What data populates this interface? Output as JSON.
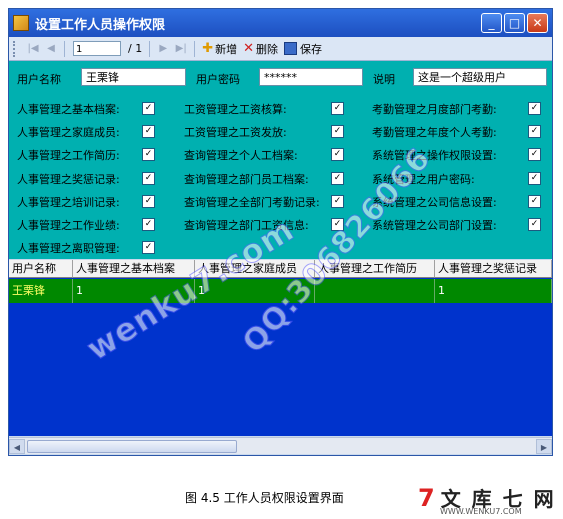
{
  "window": {
    "title": "设置工作人员操作权限",
    "btn_min": "_",
    "btn_max": "□",
    "btn_close": "✕"
  },
  "toolbar": {
    "nav_first": "|◀",
    "nav_prev": "◀",
    "position": "1",
    "total": "/ 1",
    "nav_next": "▶",
    "nav_last": "▶|",
    "add_label": "新增",
    "delete_label": "删除",
    "save_label": "保存"
  },
  "form": {
    "username_label": "用户名称",
    "username_value": "王栗锋",
    "password_label": "用户密码",
    "password_value": "******",
    "note_label": "说明",
    "note_value": "这是一个超级用户"
  },
  "permissions": {
    "col1": [
      {
        "label": "人事管理之基本档案:",
        "checked": "✓"
      },
      {
        "label": "人事管理之家庭成员:",
        "checked": "✓"
      },
      {
        "label": "人事管理之工作简历:",
        "checked": "✓"
      },
      {
        "label": "人事管理之奖惩记录:",
        "checked": "✓"
      },
      {
        "label": "人事管理之培训记录:",
        "checked": "✓"
      },
      {
        "label": "人事管理之工作业绩:",
        "checked": "✓"
      },
      {
        "label": "人事管理之离职管理:",
        "checked": "✓"
      }
    ],
    "col2": [
      {
        "label": "工资管理之工资核算:",
        "checked": "✓"
      },
      {
        "label": "工资管理之工资发放:",
        "checked": "✓"
      },
      {
        "label": "查询管理之个人工档案:",
        "checked": "✓"
      },
      {
        "label": "查询管理之部门员工档案:",
        "checked": "✓"
      },
      {
        "label": "查询管理之全部门考勤记录:",
        "checked": "✓"
      },
      {
        "label": "查询管理之部门工资信息:",
        "checked": "✓"
      }
    ],
    "col3": [
      {
        "label": "考勤管理之月度部门考勤:",
        "checked": "✓"
      },
      {
        "label": "考勤管理之年度个人考勤:",
        "checked": "✓"
      },
      {
        "label": "系统管理之操作权限设置:",
        "checked": "✓"
      },
      {
        "label": "系统管理之用户密码:",
        "checked": "✓"
      },
      {
        "label": "系统管理之公司信息设置:",
        "checked": "✓"
      },
      {
        "label": "系统管理之公司部门设置:",
        "checked": "✓"
      }
    ]
  },
  "grid": {
    "headers": [
      "用户名称",
      "人事管理之基本档案",
      "人事管理之家庭成员",
      "人事管理之工作简历",
      "人事管理之奖惩记录"
    ],
    "rows": [
      [
        "王栗锋",
        "1",
        "1",
        "",
        "1"
      ]
    ]
  },
  "scrollbar": {
    "left_arrow": "◀",
    "right_arrow": "▶"
  },
  "watermark": {
    "site": "wenku7.com",
    "qq": "QQ:306826066"
  },
  "caption": "图 4.5  工作人员权限设置界面",
  "logo": {
    "mark": "7",
    "name": "文 库 七 网",
    "url": "WWW.WENKU7.COM"
  }
}
